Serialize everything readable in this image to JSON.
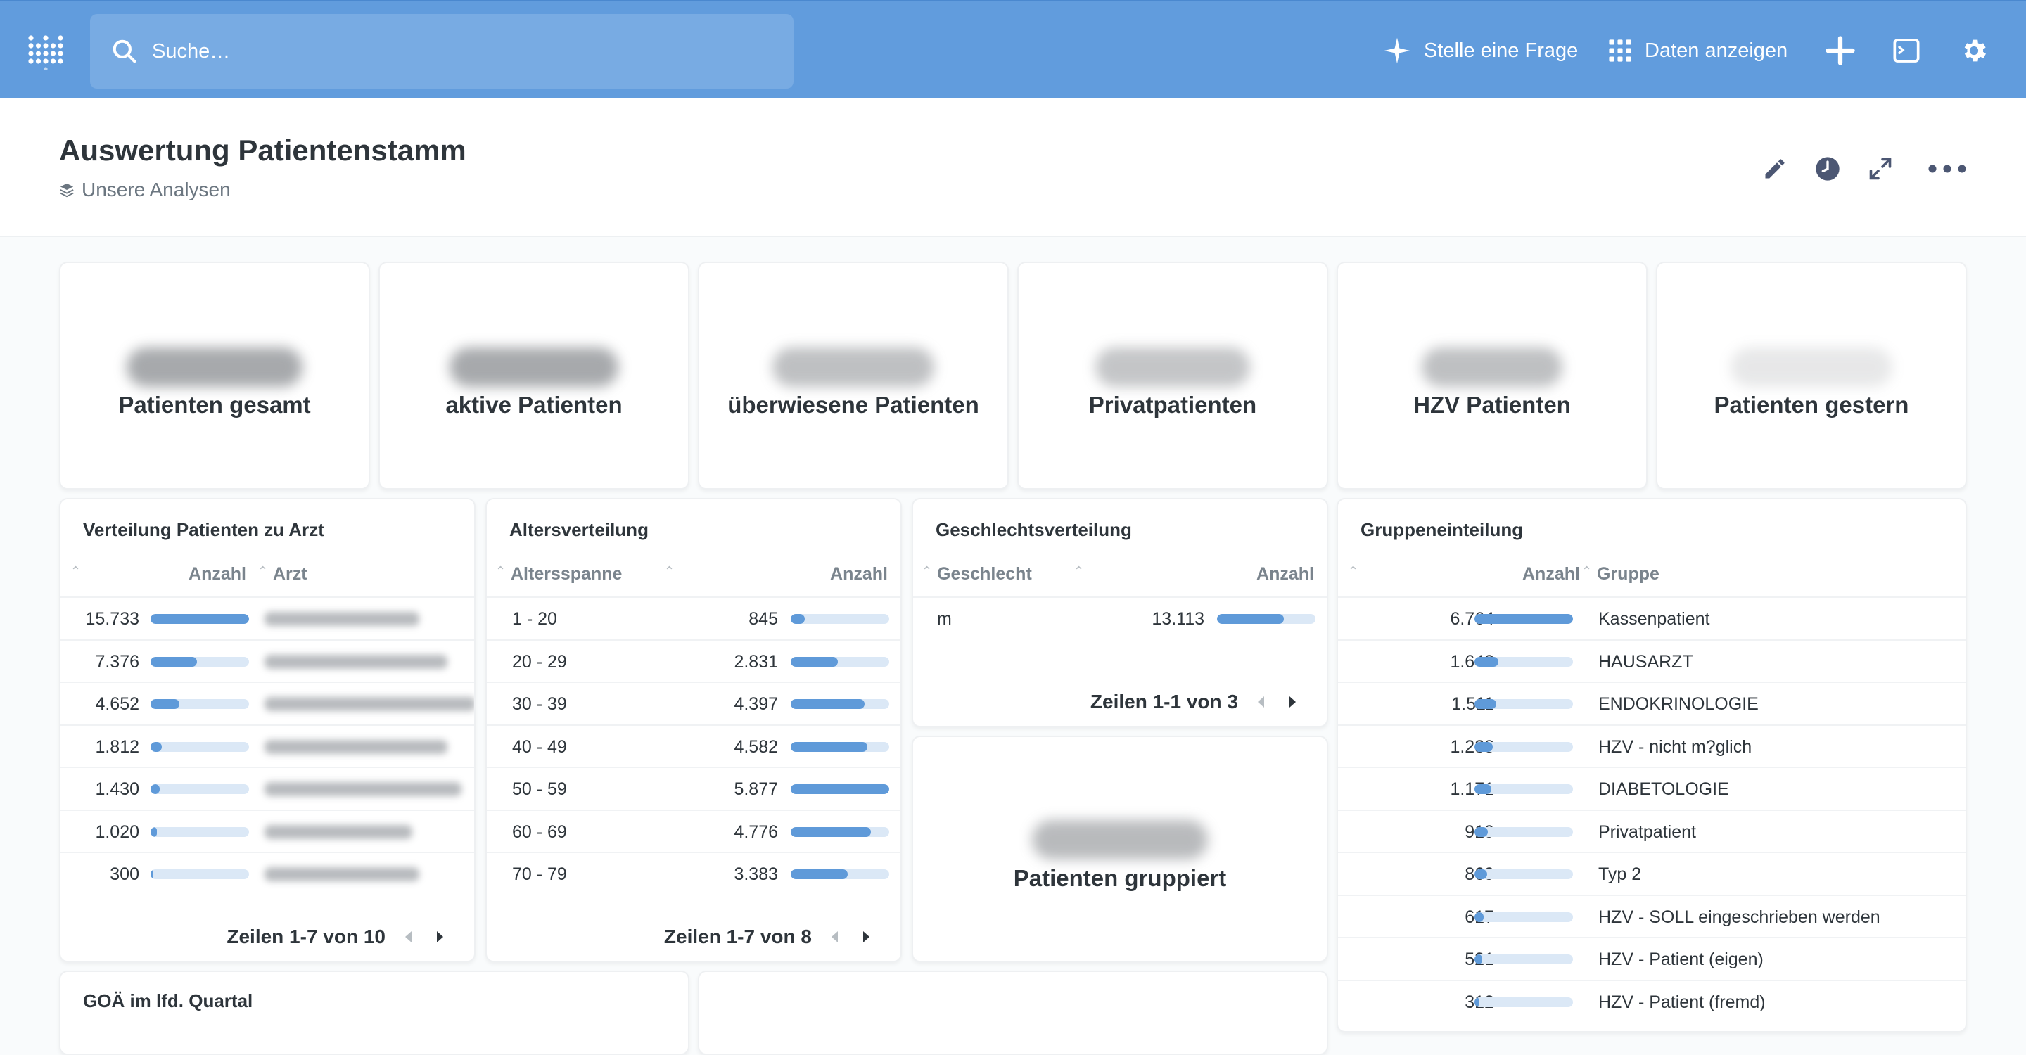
{
  "nav": {
    "search_placeholder": "Suche…",
    "ask_label": "Stelle eine Frage",
    "browse_label": "Daten anzeigen"
  },
  "header": {
    "title": "Auswertung Patientenstamm",
    "collection": "Unsere Analysen"
  },
  "kpis": [
    {
      "label": "Patienten gesamt"
    },
    {
      "label": "aktive Patienten"
    },
    {
      "label": "überwiesene Patienten"
    },
    {
      "label": "Privatpatienten"
    },
    {
      "label": "HZV Patienten"
    },
    {
      "label": "Patienten gestern"
    }
  ],
  "arzt": {
    "title": "Verteilung Patienten zu Arzt",
    "col_count": "Anzahl",
    "col_name": "Arzt",
    "rows": [
      {
        "v": "15.733",
        "f": 1.0
      },
      {
        "v": "7.376",
        "f": 0.469
      },
      {
        "v": "4.652",
        "f": 0.296
      },
      {
        "v": "1.812",
        "f": 0.115
      },
      {
        "v": "1.430",
        "f": 0.091
      },
      {
        "v": "1.020",
        "f": 0.065
      },
      {
        "v": "300",
        "f": 0.019
      }
    ],
    "pager": "Zeilen 1-7 von 10"
  },
  "alter": {
    "title": "Altersverteilung",
    "col_range": "Altersspanne",
    "col_count": "Anzahl",
    "rows": [
      {
        "r": "1 - 20",
        "v": "845",
        "f": 0.144
      },
      {
        "r": "20 - 29",
        "v": "2.831",
        "f": 0.482
      },
      {
        "r": "30 - 39",
        "v": "4.397",
        "f": 0.748
      },
      {
        "r": "40 - 49",
        "v": "4.582",
        "f": 0.78
      },
      {
        "r": "50 - 59",
        "v": "5.877",
        "f": 1.0
      },
      {
        "r": "60 - 69",
        "v": "4.776",
        "f": 0.813
      },
      {
        "r": "70 - 79",
        "v": "3.383",
        "f": 0.576
      }
    ],
    "pager": "Zeilen 1-7 von 8"
  },
  "geschlecht": {
    "title": "Geschlechtsverteilung",
    "col_sex": "Geschlecht",
    "col_count": "Anzahl",
    "rows": [
      {
        "s": "m",
        "v": "13.113",
        "f": 0.68
      }
    ],
    "pager": "Zeilen 1-1 von 3"
  },
  "gruppiert": {
    "label": "Patienten gruppiert"
  },
  "gruppe": {
    "title": "Gruppeneinteilung",
    "col_count": "Anzahl",
    "col_group": "Gruppe",
    "rows": [
      {
        "v": "6.764",
        "g": "Kassenpatient",
        "f": 1.0
      },
      {
        "v": "1.643",
        "g": "HAUSARZT",
        "f": 0.243
      },
      {
        "v": "1.511",
        "g": "ENDOKRINOLOGIE",
        "f": 0.223
      },
      {
        "v": "1.238",
        "g": "HZV - nicht m?glich",
        "f": 0.183
      },
      {
        "v": "1.171",
        "g": "DIABETOLOGIE",
        "f": 0.173
      },
      {
        "v": "919",
        "g": "Privatpatient",
        "f": 0.136
      },
      {
        "v": "869",
        "g": "Typ 2",
        "f": 0.128
      },
      {
        "v": "617",
        "g": "HZV - SOLL eingeschrieben werden",
        "f": 0.091
      },
      {
        "v": "521",
        "g": "HZV - Patient (eigen)",
        "f": 0.077
      },
      {
        "v": "312",
        "g": "HZV - Patient (fremd)",
        "f": 0.046
      }
    ]
  },
  "goa": {
    "title": "GOÄ im lfd. Quartal"
  },
  "colors": {
    "accent": "#619cdd",
    "bar": "#5f9ad9",
    "bar_track": "#dbe8f6"
  }
}
